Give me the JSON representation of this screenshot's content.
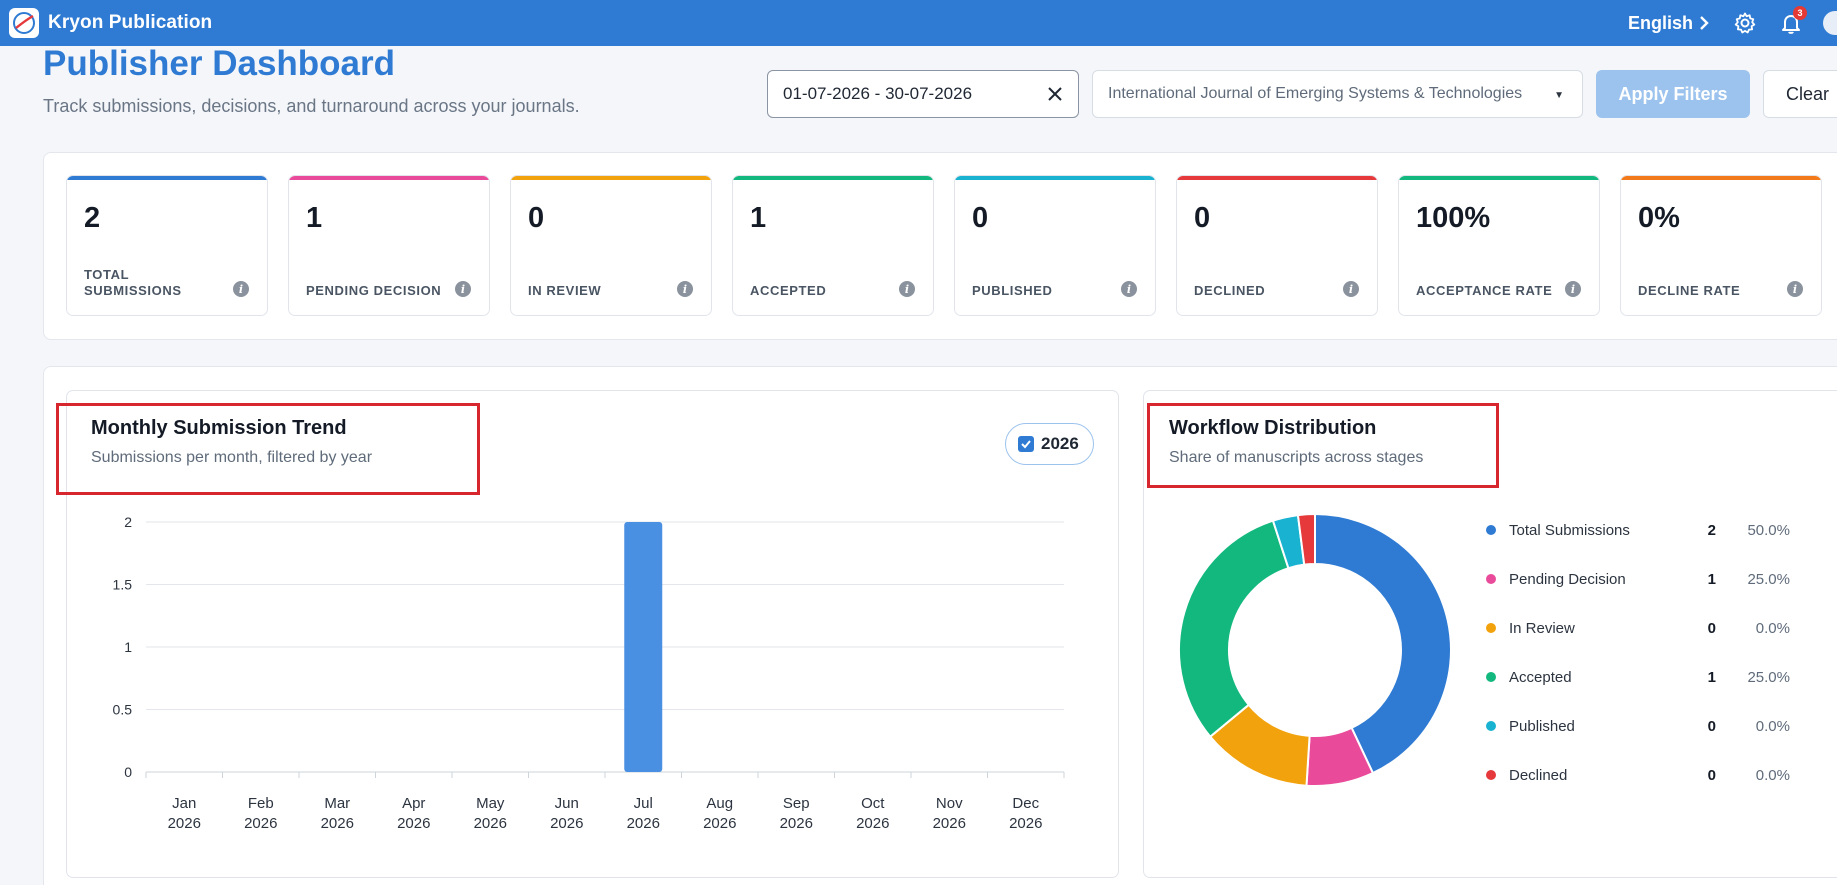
{
  "app": {
    "title": "Kryon Publication",
    "language": "English",
    "notification_count": "3"
  },
  "header": {
    "title": "Publisher Dashboard",
    "subtitle": "Track submissions, decisions, and turnaround across your journals."
  },
  "filters": {
    "date_range": "01-07-2026 - 30-07-2026",
    "journal": "International Journal of Emerging Systems & Technologies",
    "apply_label": "Apply Filters",
    "clear_label": "Clear"
  },
  "kpis": [
    {
      "value": "2",
      "label": "TOTAL SUBMISSIONS",
      "color": "#2f7bd3"
    },
    {
      "value": "1",
      "label": "PENDING DECISION",
      "color": "#e94b9a"
    },
    {
      "value": "0",
      "label": "IN REVIEW",
      "color": "#f2a20c"
    },
    {
      "value": "1",
      "label": "ACCEPTED",
      "color": "#13b87e"
    },
    {
      "value": "0",
      "label": "PUBLISHED",
      "color": "#19b3d1"
    },
    {
      "value": "0",
      "label": "DECLINED",
      "color": "#e5393b"
    },
    {
      "value": "100%",
      "label": "ACCEPTANCE RATE",
      "color": "#13b87e"
    },
    {
      "value": "0%",
      "label": "DECLINE RATE",
      "color": "#f27a1a"
    }
  ],
  "trend": {
    "title": "Monthly Submission Trend",
    "subtitle": "Submissions per month, filtered by year",
    "year_label": "2026",
    "year_checked": true
  },
  "distribution": {
    "title": "Workflow Distribution",
    "subtitle": "Share of manuscripts across stages"
  },
  "chart_data": [
    {
      "type": "bar",
      "title": "Monthly Submission Trend",
      "categories": [
        "Jan",
        "Feb",
        "Mar",
        "Apr",
        "May",
        "Jun",
        "Jul",
        "Aug",
        "Sep",
        "Oct",
        "Nov",
        "Dec"
      ],
      "category_year": "2026",
      "values": [
        0,
        0,
        0,
        0,
        0,
        0,
        2,
        0,
        0,
        0,
        0,
        0
      ],
      "ylim": [
        0,
        2
      ],
      "yticks": [
        "0",
        "0.5",
        "1",
        "1.5",
        "2"
      ],
      "color": "#4a90e2",
      "grid": true
    },
    {
      "type": "pie",
      "title": "Workflow Distribution",
      "donut": true,
      "slices": [
        {
          "name": "Total Submissions",
          "count": "2",
          "percent": "50.0%",
          "share": 0.43,
          "color": "#2f7bd3"
        },
        {
          "name": "Pending Decision",
          "count": "1",
          "percent": "25.0%",
          "share": 0.08,
          "color": "#e94b9a"
        },
        {
          "name": "In Review",
          "count": "0",
          "percent": "0.0%",
          "share": 0.13,
          "color": "#f2a20c"
        },
        {
          "name": "Accepted",
          "count": "1",
          "percent": "25.0%",
          "share": 0.31,
          "color": "#13b87e"
        },
        {
          "name": "Published",
          "count": "0",
          "percent": "0.0%",
          "share": 0.03,
          "color": "#19b3d1"
        },
        {
          "name": "Declined",
          "count": "0",
          "percent": "0.0%",
          "share": 0.02,
          "color": "#e5393b"
        }
      ]
    }
  ]
}
